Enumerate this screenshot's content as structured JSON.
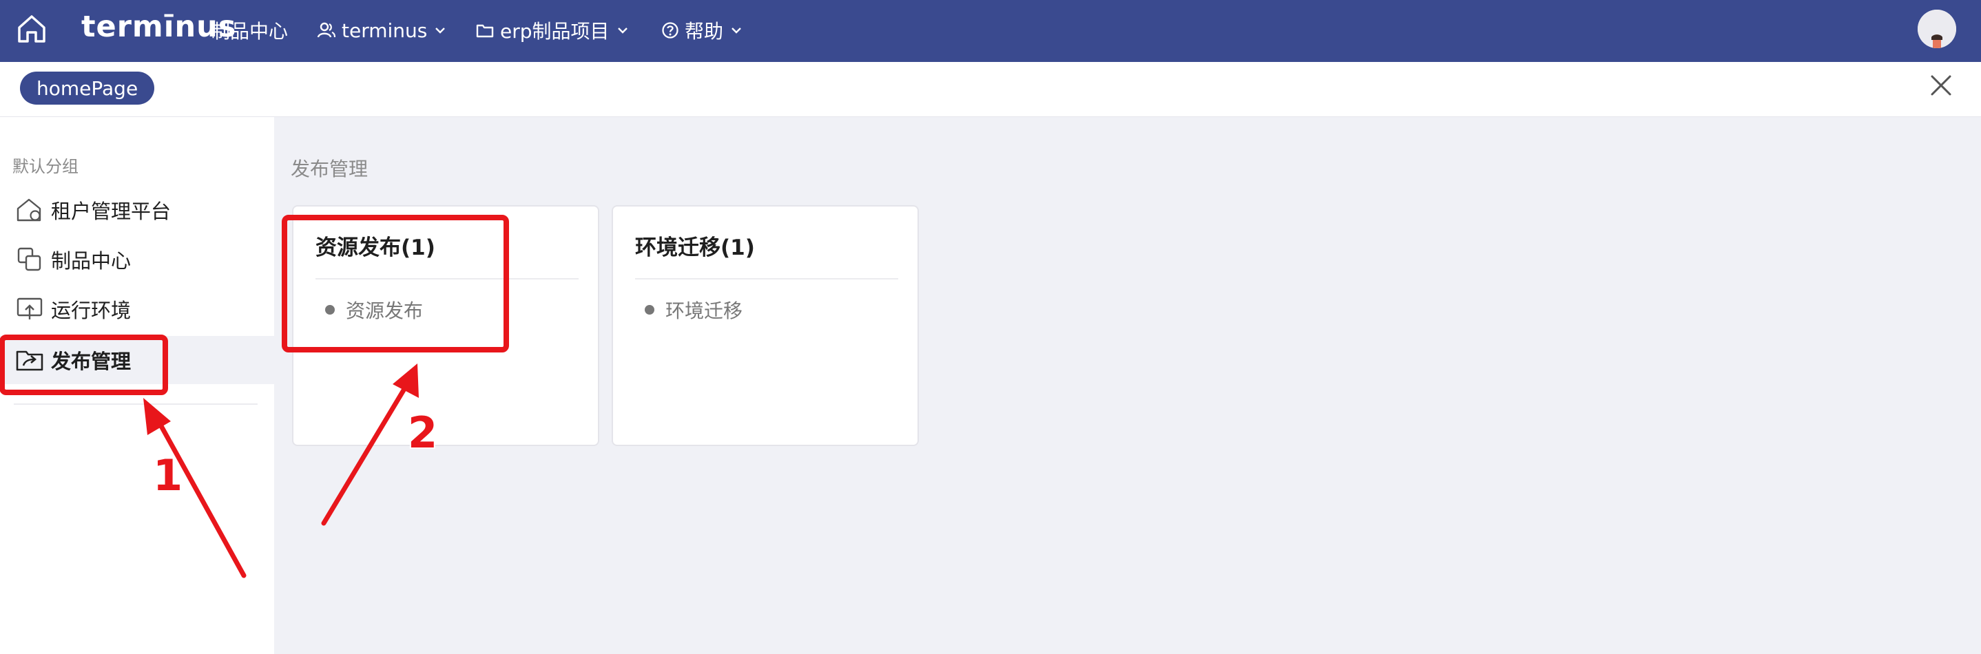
{
  "header": {
    "logo": "termīnus",
    "nav": [
      {
        "label": "制品中心"
      },
      {
        "label": "terminus"
      },
      {
        "label": "erp制品项目"
      },
      {
        "label": "帮助"
      }
    ],
    "bg_color": "#3a4a8f"
  },
  "tabbar": {
    "tabs": [
      {
        "label": "homePage"
      }
    ]
  },
  "sidebar": {
    "group_label": "默认分组",
    "items": [
      {
        "label": "租户管理平台",
        "icon": "house-user-icon"
      },
      {
        "label": "制品中心",
        "icon": "copy-icon"
      },
      {
        "label": "运行环境",
        "icon": "monitor-upload-icon"
      },
      {
        "label": "发布管理",
        "icon": "folder-share-icon",
        "active": true
      }
    ]
  },
  "main": {
    "section_title": "发布管理",
    "cards": [
      {
        "title": "资源发布(1)",
        "links": [
          "资源发布"
        ]
      },
      {
        "title": "环境迁移(1)",
        "links": [
          "环境迁移"
        ]
      }
    ]
  },
  "annotations": {
    "labels": [
      "1",
      "2"
    ],
    "color": "#e8161b"
  }
}
